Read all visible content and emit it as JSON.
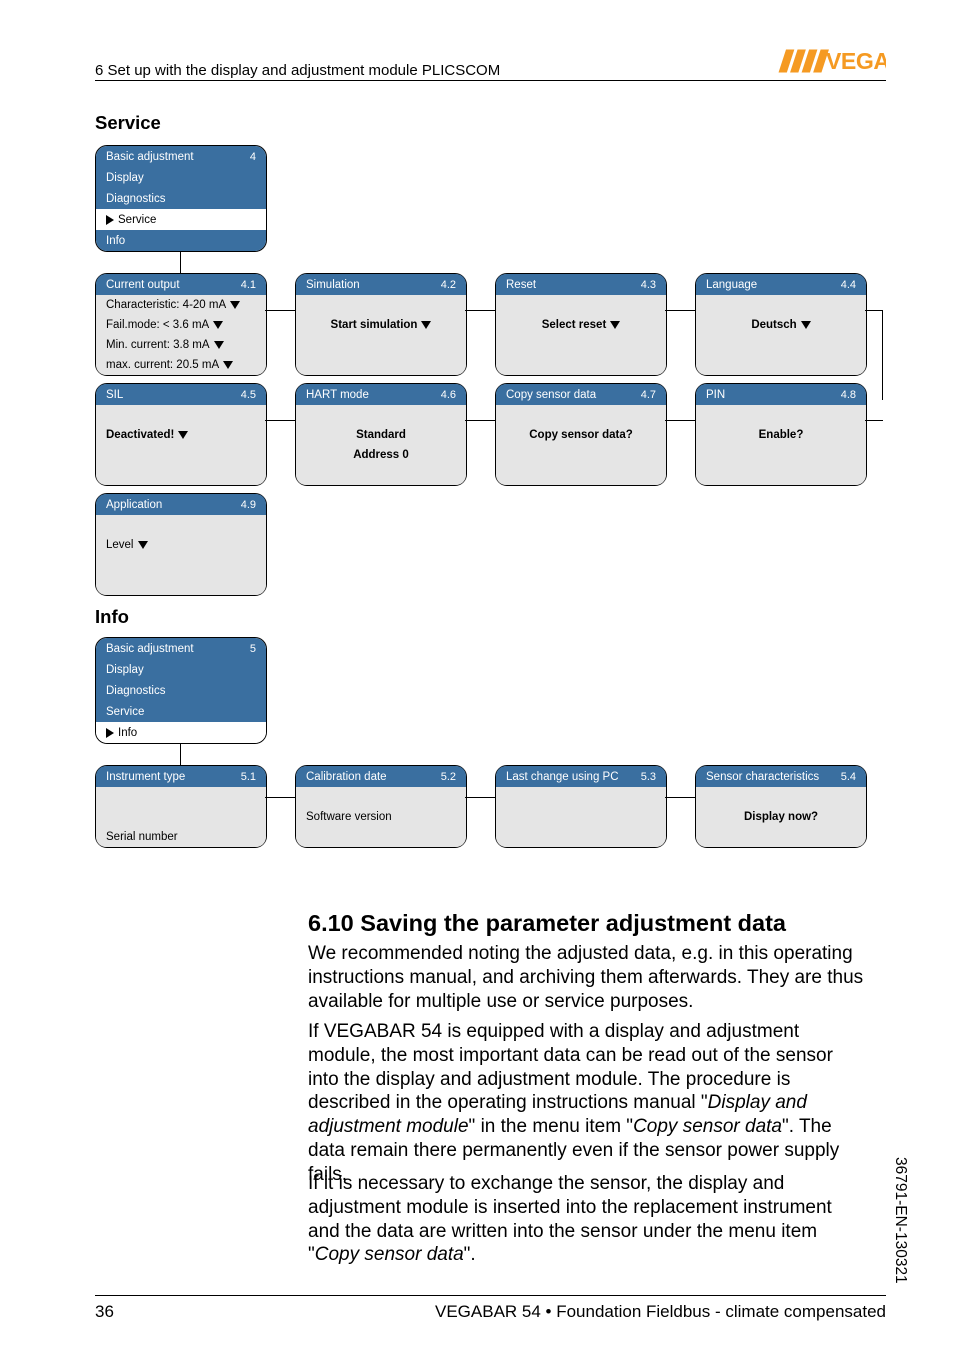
{
  "header": "6 Set up with the display and adjustment module PLICSCOM",
  "logo": {
    "text": "VEGA"
  },
  "section_service": "Service",
  "section_info": "Info",
  "menu_service": {
    "number": "4",
    "items": [
      "Basic adjustment",
      "Display",
      "Diagnostics",
      "Service",
      "Info"
    ],
    "selected": 3
  },
  "menu_info": {
    "number": "5",
    "items": [
      "Basic adjustment",
      "Display",
      "Diagnostics",
      "Service",
      "Info"
    ],
    "selected": 4
  },
  "box_4_1": {
    "title": "Current output",
    "num": "4.1",
    "lines": [
      "Characteristic: 4-20 mA",
      "Fail.mode: < 3.6 mA",
      "Min. current: 3.8 mA",
      "max. current: 20.5 mA"
    ],
    "has_tri": [
      true,
      true,
      true,
      true
    ]
  },
  "box_4_2": {
    "title": "Simulation",
    "num": "4.2",
    "center_bold": "Start simulation",
    "has_tri": true
  },
  "box_4_3": {
    "title": "Reset",
    "num": "4.3",
    "center_bold": "Select reset",
    "has_tri": true
  },
  "box_4_4": {
    "title": "Language",
    "num": "4.4",
    "center_bold": "Deutsch",
    "has_tri": true
  },
  "box_4_5": {
    "title": "SIL",
    "num": "4.5",
    "left_bold": "Deactivated!",
    "has_tri": true
  },
  "box_4_6": {
    "title": "HART mode",
    "num": "4.6",
    "center_bold": "Standard",
    "line2": "Address 0"
  },
  "box_4_7": {
    "title": "Copy sensor data",
    "num": "4.7",
    "center_bold": "Copy sensor data?"
  },
  "box_4_8": {
    "title": "PIN",
    "num": "4.8",
    "center_bold": "Enable?"
  },
  "box_4_9": {
    "title": "Application",
    "num": "4.9",
    "left": "Level",
    "has_tri": true
  },
  "box_5_1": {
    "title": "Instrument type",
    "num": "5.1",
    "line2": "Serial number"
  },
  "box_5_2": {
    "title": "Calibration date",
    "num": "5.2",
    "line2": "Software version"
  },
  "box_5_3": {
    "title": "Last change using PC",
    "num": "5.3"
  },
  "box_5_4": {
    "title": "Sensor characteristics",
    "num": "5.4",
    "center_bold": "Display now?"
  },
  "heading_610": "6.10  Saving the parameter adjustment data",
  "p1": "We recommended noting the adjusted data, e.g. in this operating instructions manual, and archiving them afterwards. They are thus available for multiple use or service purposes.",
  "p2a": "If VEGABAR 54 is equipped with a display and adjustment module, the most important data can be read out of the sensor into the display and adjustment module. The procedure is described in the operating instructions manual \"",
  "p2b": "Display and adjustment module",
  "p2c": "\" in the menu item \"",
  "p2d": "Copy sensor data",
  "p2e": "\". The data remain there permanently even if the sensor power supply fails.",
  "p3a": "If it is necessary to exchange the sensor, the display and adjustment module is inserted into the replacement instrument and the data are written into the sensor under the menu item \"",
  "p3b": "Copy sensor data",
  "p3c": "\".",
  "footer": {
    "page": "36",
    "center": "VEGABAR 54 • Foundation Fieldbus - climate compensated"
  },
  "side": "36791-EN-130321"
}
